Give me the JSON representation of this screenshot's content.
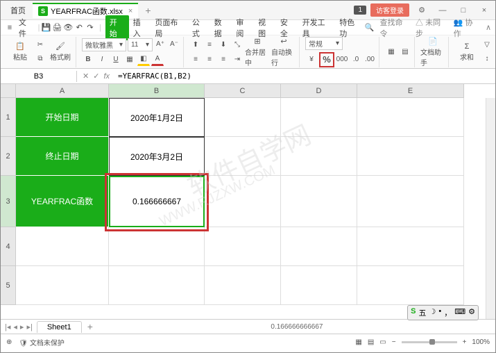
{
  "titlebar": {
    "home": "首页",
    "filename": "YEARFRAC函数.xlsx",
    "file_badge": "S",
    "notif": "1",
    "guest": "访客登录"
  },
  "menubar": {
    "file": "文件",
    "tabs": [
      "开始",
      "插入",
      "页面布局",
      "公式",
      "数据",
      "审阅",
      "视图",
      "安全",
      "开发工具",
      "特色功"
    ],
    "search_ph": "查找命令",
    "not_sync": "未同步",
    "collab": "协作"
  },
  "ribbon": {
    "paste": "粘贴",
    "format_painter": "格式刷",
    "font": "微软雅黑",
    "size": "11",
    "merge": "合并居中",
    "wrap": "自动换行",
    "num_format": "常规",
    "doc_helper": "文档助手",
    "sum": "求和"
  },
  "formula": {
    "cell_ref": "B3",
    "fx": "fx",
    "content": "=YEARFRAC(B1,B2)"
  },
  "cols": [
    "A",
    "B",
    "C",
    "D",
    "E"
  ],
  "rows": [
    "1",
    "2",
    "3",
    "4",
    "5"
  ],
  "cells": {
    "A1": "开始日期",
    "B1": "2020年1月2日",
    "A2": "终止日期",
    "B2": "2020年3月2日",
    "A3": "YEARFRAC函数",
    "B3": "0.166666667"
  },
  "watermark1": "软件自学网",
  "watermark2": "WWW.RJZXW.COM",
  "sheet_tabs": {
    "sheet1": "Sheet1"
  },
  "statusbar": {
    "protect": "文档未保护",
    "value": "0.166666666667",
    "zoom": "100%"
  },
  "ime": {
    "label": "五",
    "dot": "•"
  },
  "chart_data": {
    "type": "table",
    "title": "YEARFRAC函数",
    "fields": [
      "开始日期",
      "终止日期",
      "YEARFRAC函数"
    ],
    "values": [
      "2020年1月2日",
      "2020年3月2日",
      0.166666667
    ],
    "formula": "=YEARFRAC(B1,B2)"
  }
}
